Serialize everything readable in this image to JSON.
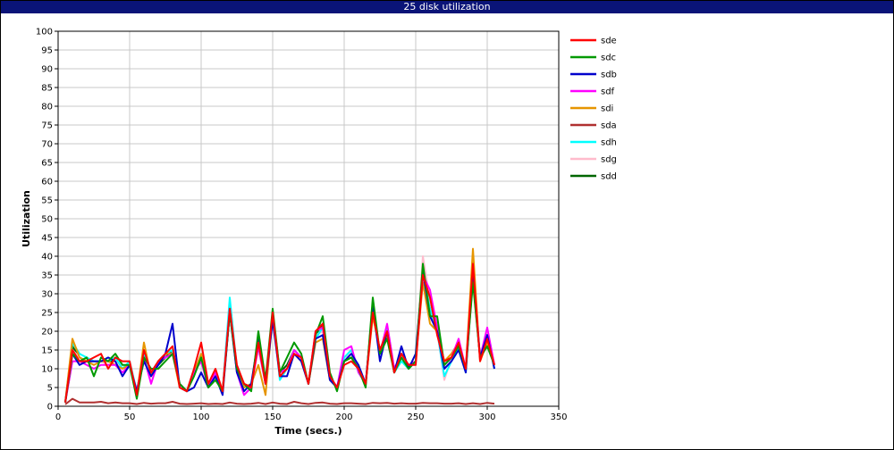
{
  "window": {
    "title": "25 disk utilization"
  },
  "chart_data": {
    "type": "line",
    "title": "25 disk utilization",
    "xlabel": "Time (secs.)",
    "ylabel": "Utilization",
    "xlim": [
      0,
      350
    ],
    "ylim": [
      0,
      100
    ],
    "xticks": [
      0,
      50,
      100,
      150,
      200,
      250,
      300,
      350
    ],
    "yticks": [
      0,
      5,
      10,
      15,
      20,
      25,
      30,
      35,
      40,
      45,
      50,
      55,
      60,
      65,
      70,
      75,
      80,
      85,
      90,
      95,
      100
    ],
    "grid": true,
    "legend_position": "right",
    "x": [
      5,
      10,
      15,
      20,
      25,
      30,
      35,
      40,
      45,
      50,
      55,
      60,
      65,
      70,
      75,
      80,
      85,
      90,
      95,
      100,
      105,
      110,
      115,
      120,
      125,
      130,
      135,
      140,
      145,
      150,
      155,
      160,
      165,
      170,
      175,
      180,
      185,
      190,
      195,
      200,
      205,
      210,
      215,
      220,
      225,
      230,
      235,
      240,
      245,
      250,
      255,
      260,
      265,
      270,
      275,
      280,
      285,
      290,
      295,
      300,
      305
    ],
    "series": [
      {
        "name": "sde",
        "color": "#ff0000",
        "values": [
          1,
          15,
          12,
          12,
          13,
          14,
          10,
          13,
          12,
          12,
          3,
          15,
          9,
          12,
          14,
          16,
          5,
          4,
          10,
          17,
          6,
          10,
          4,
          26,
          11,
          6,
          5,
          17,
          6,
          25,
          8,
          10,
          14,
          13,
          6,
          20,
          22,
          8,
          5,
          11,
          12,
          10,
          6,
          25,
          15,
          20,
          9,
          14,
          11,
          11,
          35,
          29,
          19,
          12,
          13,
          17,
          10,
          38,
          12,
          18,
          11
        ]
      },
      {
        "name": "sdc",
        "color": "#009900",
        "values": [
          1,
          14,
          12,
          13,
          8,
          13,
          12,
          14,
          11,
          11,
          2,
          13,
          10,
          10,
          12,
          14,
          6,
          4,
          8,
          13,
          5,
          7,
          4,
          25,
          10,
          6,
          4,
          20,
          7,
          26,
          9,
          13,
          17,
          14,
          6,
          19,
          24,
          9,
          4,
          12,
          13,
          10,
          5,
          29,
          14,
          18,
          9,
          13,
          10,
          12,
          38,
          24,
          24,
          11,
          13,
          16,
          10,
          33,
          13,
          16,
          11
        ]
      },
      {
        "name": "sdb",
        "color": "#0000cc",
        "values": [
          1,
          14,
          11,
          12,
          12,
          12,
          13,
          12,
          8,
          11,
          4,
          12,
          8,
          11,
          14,
          22,
          5,
          4,
          5,
          9,
          5,
          8,
          3,
          25,
          9,
          4,
          6,
          18,
          6,
          23,
          8,
          8,
          14,
          12,
          6,
          18,
          19,
          7,
          5,
          12,
          14,
          11,
          6,
          27,
          12,
          20,
          9,
          16,
          10,
          14,
          36,
          24,
          20,
          10,
          12,
          15,
          9,
          36,
          13,
          19,
          10
        ]
      },
      {
        "name": "sdf",
        "color": "#ff00ff",
        "values": [
          1,
          12,
          12,
          11,
          10,
          11,
          11,
          11,
          9,
          11,
          4,
          13,
          6,
          12,
          13,
          14,
          6,
          4,
          9,
          12,
          5,
          9,
          4,
          26,
          9,
          3,
          5,
          16,
          6,
          24,
          9,
          10,
          15,
          13,
          6,
          20,
          21,
          8,
          5,
          15,
          16,
          9,
          6,
          26,
          14,
          22,
          10,
          14,
          11,
          12,
          35,
          31,
          21,
          11,
          13,
          18,
          10,
          36,
          13,
          21,
          11
        ]
      },
      {
        "name": "sdi",
        "color": "#e69500",
        "values": [
          1,
          18,
          13,
          12,
          11,
          12,
          12,
          11,
          10,
          11,
          3,
          17,
          8,
          12,
          14,
          14,
          5,
          4,
          9,
          14,
          6,
          9,
          4,
          25,
          9,
          5,
          6,
          11,
          3,
          24,
          9,
          10,
          14,
          12,
          6,
          17,
          18,
          7,
          5,
          12,
          13,
          10,
          6,
          24,
          15,
          19,
          9,
          14,
          11,
          12,
          33,
          22,
          20,
          12,
          14,
          17,
          10,
          42,
          12,
          17,
          11
        ]
      },
      {
        "name": "sda",
        "color": "#b03030",
        "values": [
          0.5,
          2,
          1,
          1,
          1,
          1.2,
          0.8,
          1,
          0.8,
          0.8,
          0.6,
          0.9,
          0.7,
          0.8,
          0.8,
          1.2,
          0.7,
          0.6,
          0.7,
          0.8,
          0.6,
          0.7,
          0.6,
          1,
          0.7,
          0.6,
          0.7,
          0.9,
          0.6,
          1,
          0.7,
          0.6,
          1.2,
          0.8,
          0.6,
          0.9,
          1,
          0.7,
          0.6,
          0.8,
          0.8,
          0.7,
          0.6,
          0.9,
          0.8,
          0.9,
          0.7,
          0.8,
          0.7,
          0.7,
          0.9,
          0.8,
          0.8,
          0.7,
          0.7,
          0.8,
          0.6,
          0.8,
          0.6,
          0.9,
          0.7
        ]
      },
      {
        "name": "sdh",
        "color": "#00ffff",
        "values": [
          1,
          17,
          14,
          13,
          12,
          12,
          12,
          13,
          10,
          12,
          4,
          14,
          9,
          12,
          14,
          15,
          6,
          4,
          9,
          14,
          6,
          8,
          4,
          29,
          10,
          5,
          6,
          16,
          6,
          25,
          7,
          10,
          15,
          13,
          6,
          18,
          21,
          8,
          5,
          13,
          15,
          9,
          6,
          25,
          14,
          21,
          9,
          12,
          10,
          12,
          36,
          26,
          20,
          8,
          12,
          16,
          9,
          34,
          13,
          19,
          10
        ]
      },
      {
        "name": "sdg",
        "color": "#ffbbcc",
        "values": [
          1,
          15,
          13,
          12,
          11,
          12,
          11,
          12,
          10,
          11,
          4,
          14,
          8,
          12,
          14,
          15,
          6,
          4,
          9,
          13,
          6,
          9,
          4,
          25,
          10,
          5,
          6,
          15,
          6,
          24,
          9,
          10,
          15,
          13,
          6,
          19,
          20,
          8,
          5,
          13,
          14,
          10,
          6,
          26,
          14,
          20,
          9,
          13,
          11,
          12,
          40,
          28,
          20,
          7,
          13,
          18,
          10,
          35,
          13,
          20,
          11
        ]
      },
      {
        "name": "sdd",
        "color": "#006600",
        "values": [
          1,
          16,
          13,
          12,
          12,
          12,
          12,
          12,
          10,
          11,
          4,
          14,
          9,
          11,
          13,
          15,
          6,
          4,
          9,
          13,
          6,
          8,
          4,
          25,
          10,
          6,
          5,
          17,
          6,
          25,
          9,
          11,
          15,
          13,
          6,
          19,
          22,
          8,
          5,
          12,
          13,
          10,
          6,
          26,
          14,
          20,
          9,
          13,
          10,
          12,
          36,
          27,
          21,
          11,
          13,
          16,
          10,
          34,
          13,
          18,
          11
        ]
      }
    ]
  }
}
